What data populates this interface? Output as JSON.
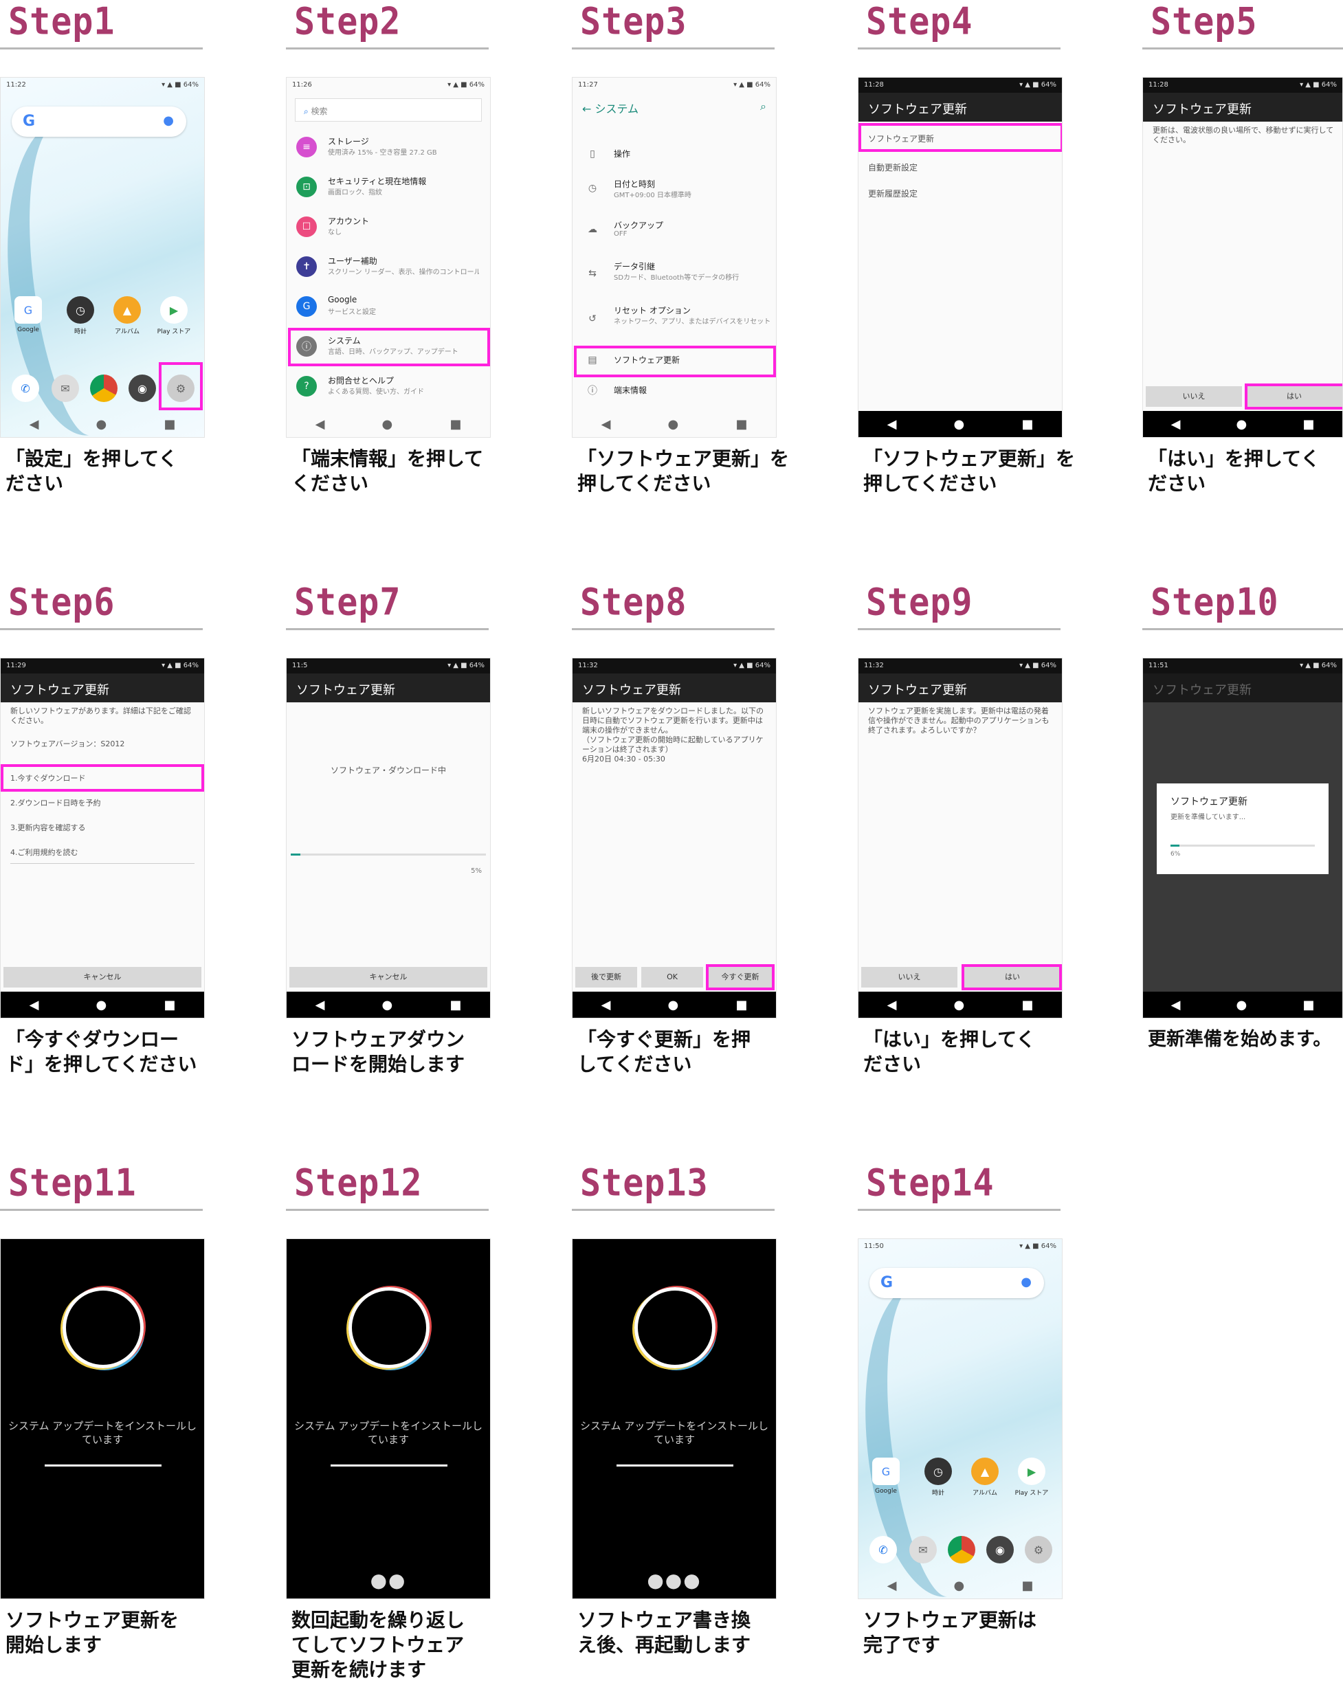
{
  "steps": [
    {
      "title": "Step1",
      "caption": "「設定」を押してく\nださい"
    },
    {
      "title": "Step2",
      "caption": "「端末情報」を押して\nください"
    },
    {
      "title": "Step3",
      "caption": "「ソフトウェア更新」を\n押してください"
    },
    {
      "title": "Step4",
      "caption": "「ソフトウェア更新」を\n押してください"
    },
    {
      "title": "Step5",
      "caption": "「はい」を押してく\nださい"
    },
    {
      "title": "Step6",
      "caption": "「今すぐダウンロー\nド」を押してください"
    },
    {
      "title": "Step7",
      "caption": "ソフトウェアダウン\nロードを開始します"
    },
    {
      "title": "Step8",
      "caption": "「今すぐ更新」を押\nしてください"
    },
    {
      "title": "Step9",
      "caption": "「はい」を押してく\nださい"
    },
    {
      "title": "Step10",
      "caption": "更新準備を始めます。"
    },
    {
      "title": "Step11",
      "caption": "ソフトウェア更新を\n開始します"
    },
    {
      "title": "Step12",
      "caption": "数回起動を繰り返し\nてしてソフトウェア\n更新を続けます"
    },
    {
      "title": "Step13",
      "caption": "ソフトウェア書き換\nえ後、再起動します"
    },
    {
      "title": "Step14",
      "caption": "ソフトウェア更新は\n完了です"
    }
  ],
  "screens": {
    "status_time": [
      "11:22",
      "11:26",
      "11:27",
      "11:28",
      "11:28",
      "11:29",
      "11:5",
      "11:32",
      "11:32",
      "11:51",
      "11:50"
    ],
    "status_right": "▾ ▲ ■ 64%",
    "home": {
      "apps": [
        "Google",
        "時計",
        "アルバム",
        "Play ストア"
      ]
    },
    "settings": {
      "search": "検索",
      "items": [
        {
          "t": "ストレージ",
          "s": "使用済み 15% - 空き容量 27.2 GB"
        },
        {
          "t": "セキュリティと現在地情報",
          "s": "画面ロック、指紋"
        },
        {
          "t": "アカウント",
          "s": "なし"
        },
        {
          "t": "ユーザー補助",
          "s": "スクリーン リーダー、表示、操作のコントロール"
        },
        {
          "t": "Google",
          "s": "サービスと設定"
        },
        {
          "t": "システム",
          "s": "言語、日時、バックアップ、アップデート"
        },
        {
          "t": "お問合せとヘルプ",
          "s": "よくある質問、使い方、ガイド"
        }
      ]
    },
    "system": {
      "title": "システム",
      "items": [
        {
          "t": "操作",
          "s": ""
        },
        {
          "t": "日付と時刻",
          "s": "GMT+09:00 日本標準時"
        },
        {
          "t": "バックアップ",
          "s": "OFF"
        },
        {
          "t": "データ引継",
          "s": "SDカード、Bluetooth等でデータの移行"
        },
        {
          "t": "リセット オプション",
          "s": "ネットワーク、アプリ、またはデバイスをリセット"
        },
        {
          "t": "ソフトウェア更新",
          "s": ""
        },
        {
          "t": "端末情報",
          "s": ""
        }
      ]
    },
    "sw_title": "ソフトウェア更新",
    "sw_menu": [
      "ソフトウェア更新",
      "自動更新設定",
      "更新履歴設定"
    ],
    "confirm_text": "更新は、電波状態の良い場所で、移動せずに実行してください。",
    "buttons": {
      "no": "いいえ",
      "yes": "はい",
      "cancel": "キャンセル",
      "later": "後で更新",
      "ok": "OK",
      "now": "今すぐ更新"
    },
    "download_info": "新しいソフトウェアがあります。詳細は下記をご確認ください。",
    "version": "ソフトウェアバージョン：S2012",
    "download_options": [
      "1.今すぐダウンロード",
      "2.ダウンロード日時を予約",
      "3.更新内容を確認する",
      "4.ご利用規約を読む"
    ],
    "downloading": "ソフトウェア・ダウンロード中",
    "percent": "5%",
    "update_notice": "新しいソフトウェアをダウンロードしました。以下の日時に自動でソフトウェア更新を行います。更新中は端末の操作ができません。\n（ソフトウェア更新の開始時に起動しているアプリケーションは終了されます）\n6月20日 04:30 - 05:30",
    "restart_notice": "ソフトウェア更新を実施します。更新中は電話の発着信や操作ができません。起動中のアプリケーションも終了されます。よろしいですか？",
    "dialog_title": "ソフトウェア更新",
    "dialog_text": "更新を準備しています...",
    "dialog_pct": "6%",
    "installing": "システム アップデートをインストールしています"
  }
}
